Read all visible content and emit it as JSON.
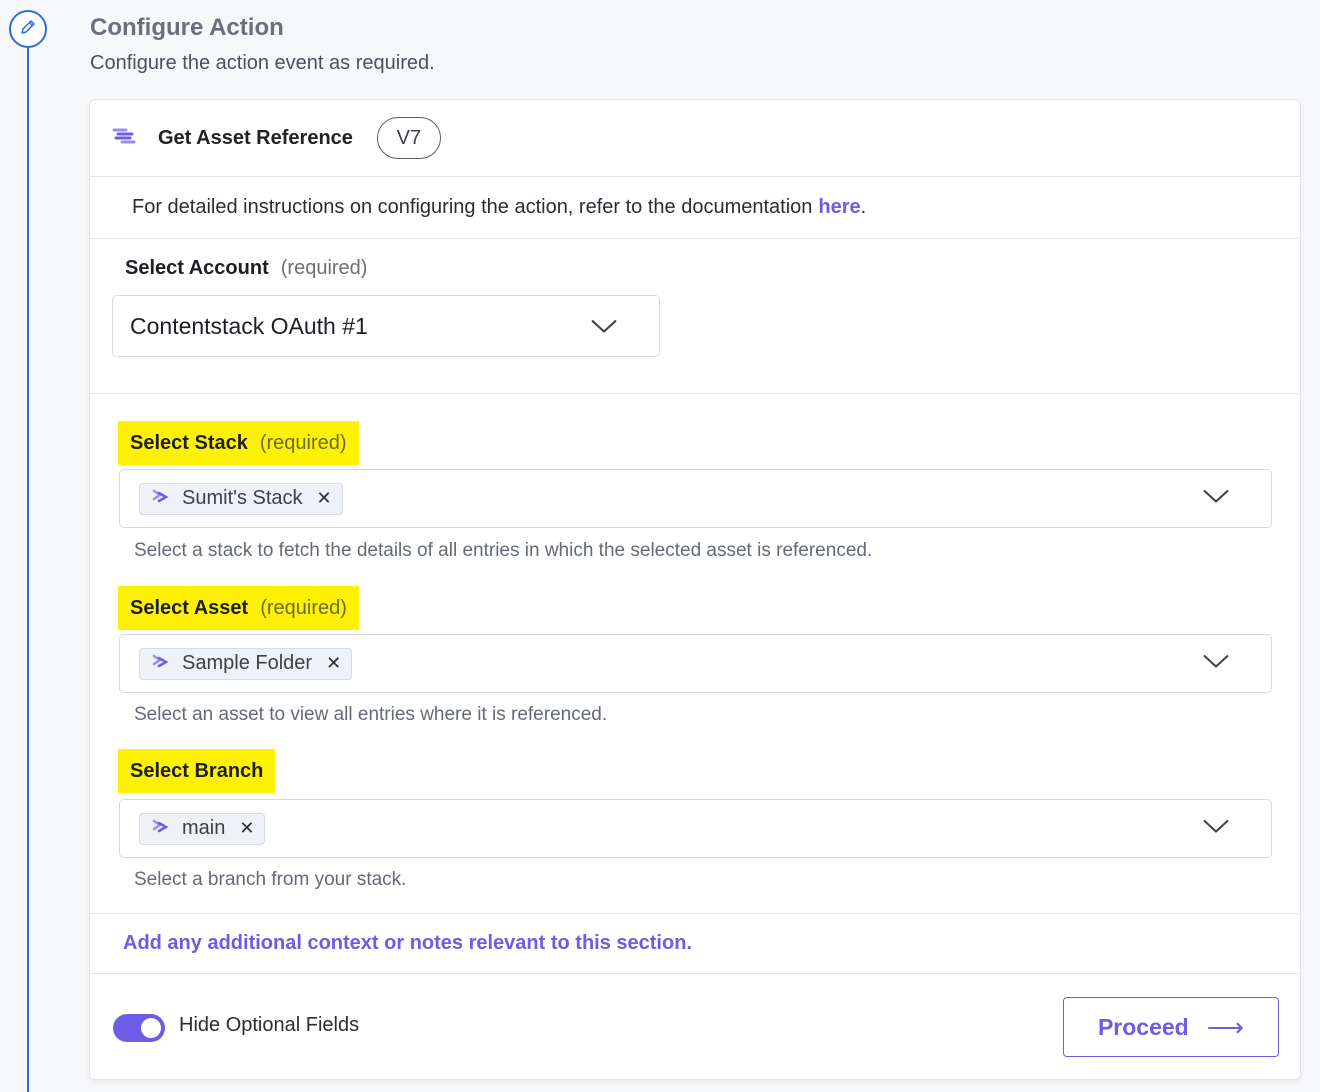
{
  "header": {
    "title": "Configure Action",
    "subtitle": "Configure the action event as required."
  },
  "card": {
    "action_name": "Get Asset Reference",
    "version": "V7",
    "doc_text": "For detailed instructions on configuring the action, refer to the documentation",
    "doc_link": "here",
    "doc_suffix": "."
  },
  "account": {
    "label": "Select Account",
    "required": "(required)",
    "value": "Contentstack OAuth #1"
  },
  "stack": {
    "label": "Select Stack",
    "required": "(required)",
    "chip": "Sumit's Stack",
    "help": "Select a stack to fetch the details of all entries in which the selected asset is referenced."
  },
  "asset": {
    "label": "Select Asset",
    "required": "(required)",
    "chip": "Sample Folder",
    "help": "Select an asset to view all entries where it is referenced."
  },
  "branch": {
    "label": "Select Branch",
    "chip": "main",
    "help": "Select a branch from your stack."
  },
  "notes": "Add any additional context or notes relevant to this section.",
  "footer": {
    "toggle_label": "Hide Optional Fields",
    "toggle_on": true,
    "proceed_label": "Proceed",
    "proceed_arrow": "⟶"
  },
  "colors": {
    "accent": "#6c5ce7",
    "timeline": "#2f6bd8",
    "highlight": "#fff200"
  },
  "icons": {
    "step": "pencil-icon",
    "app": "contentstack-logo-icon",
    "chip": "contentstack-logo-icon",
    "dropdown": "chevron-down-icon",
    "remove": "close-icon"
  }
}
